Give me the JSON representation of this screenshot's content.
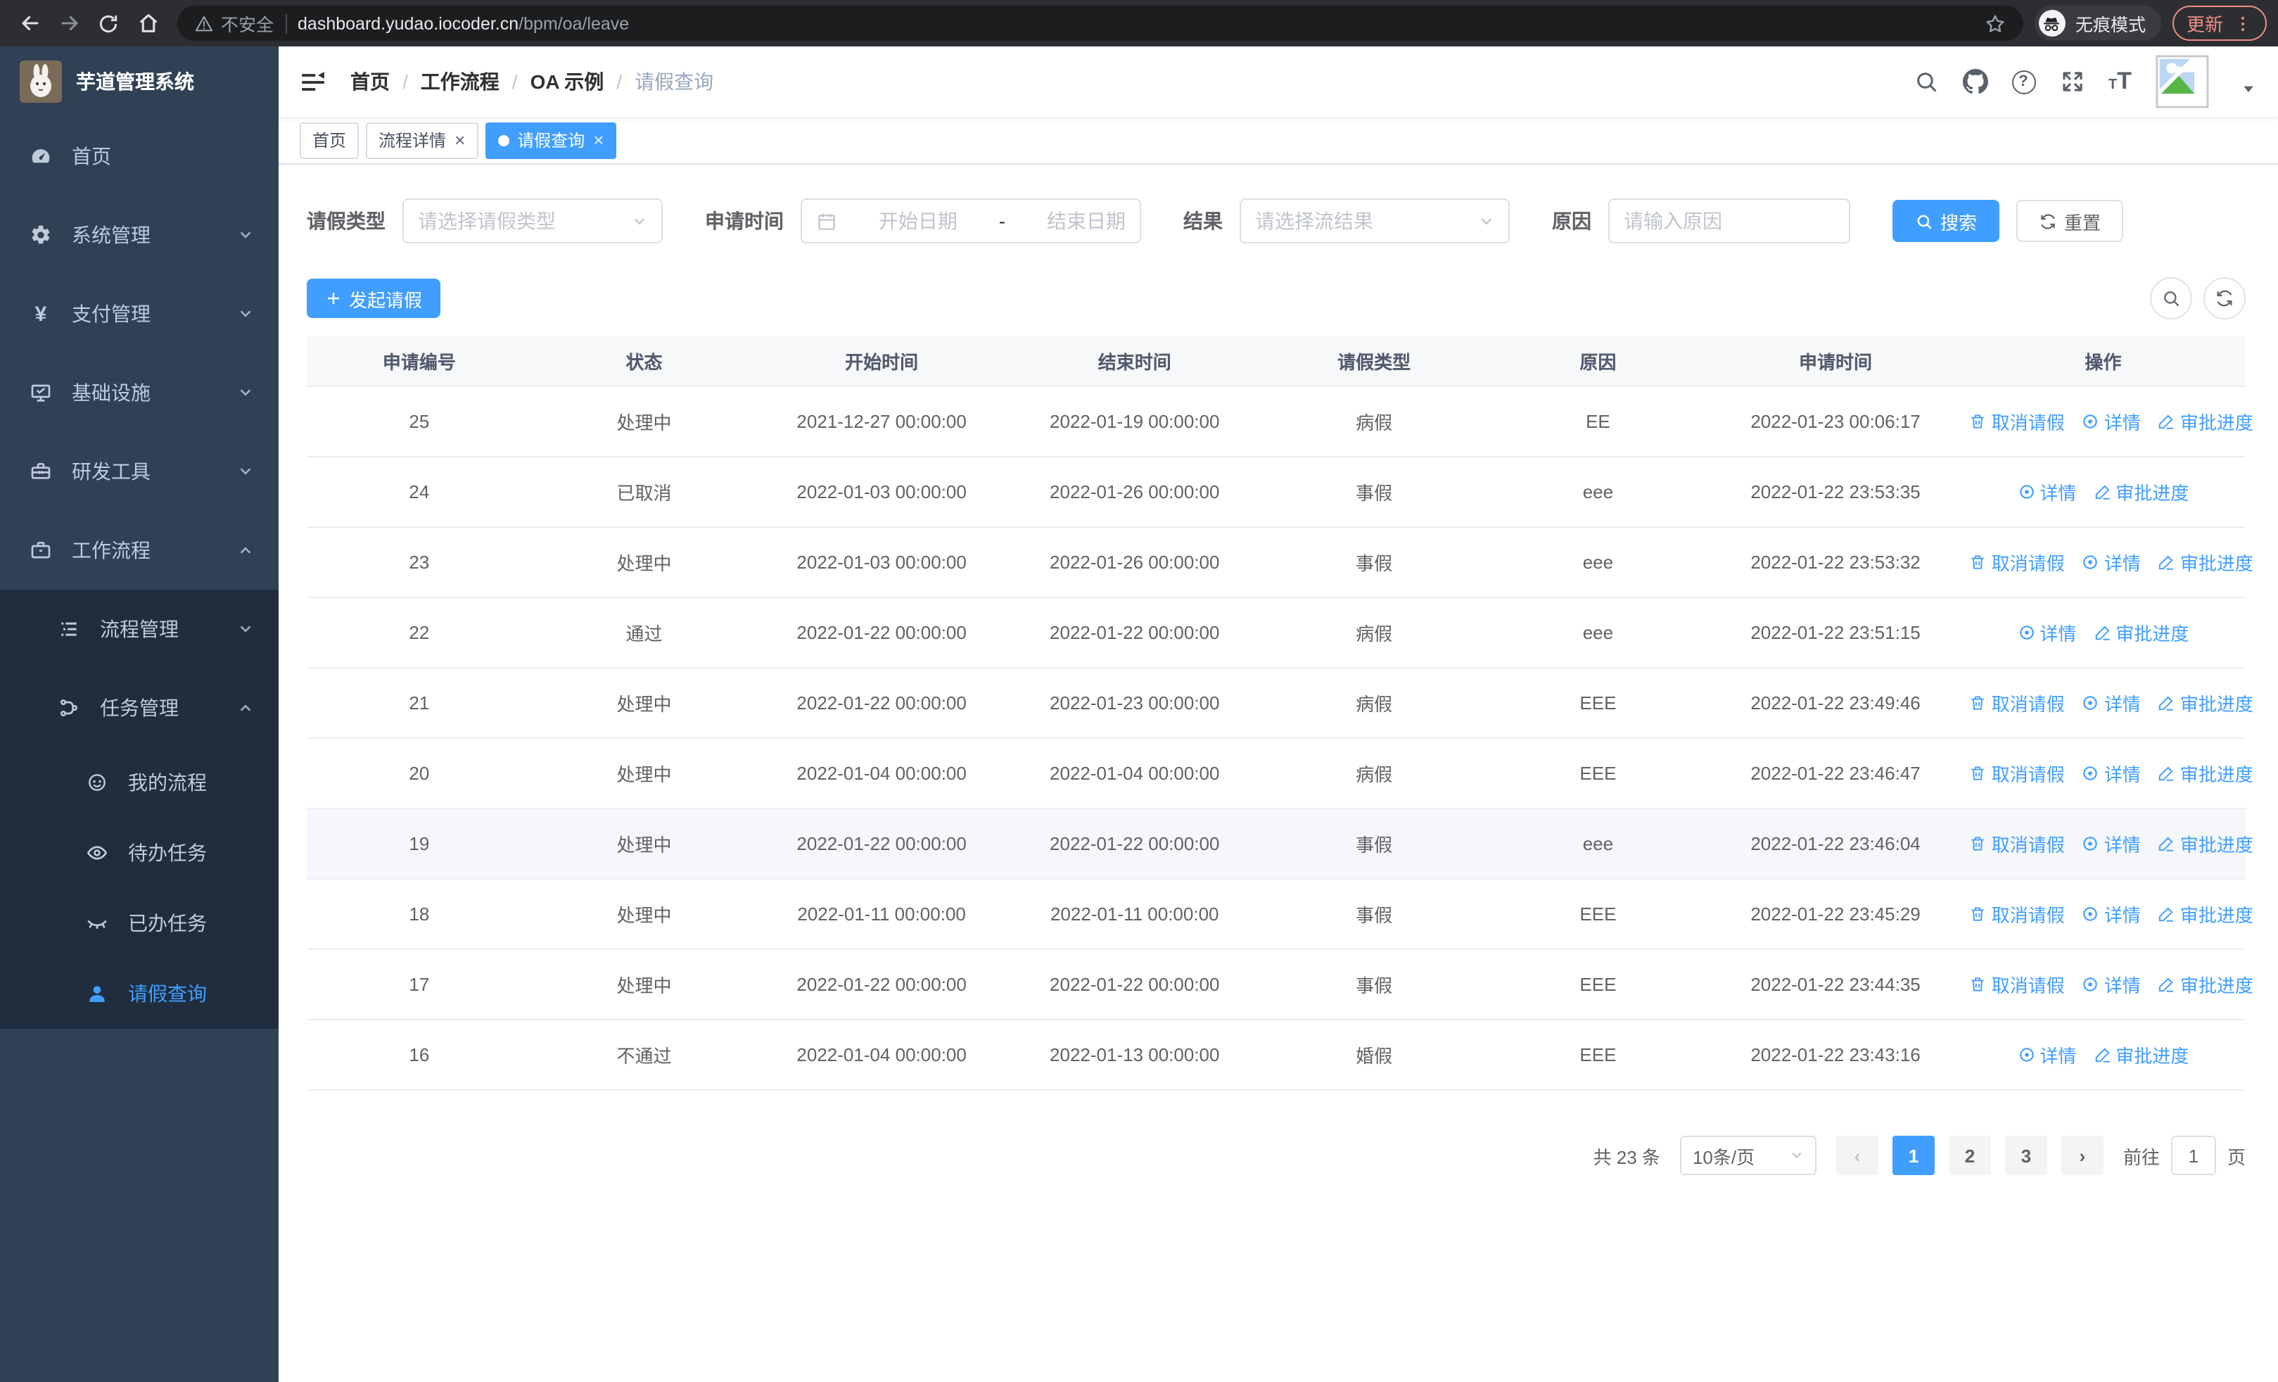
{
  "browser": {
    "security_label": "不安全",
    "url_host": "dashboard.yudao.iocoder.cn",
    "url_path": "/bpm/oa/leave",
    "incognito_label": "无痕模式",
    "update_label": "更新"
  },
  "sidebar": {
    "logo_title": "芋道管理系统",
    "menu": [
      {
        "name": "home",
        "label": "首页",
        "icon": "dashboard",
        "level": 1
      },
      {
        "name": "system-mgmt",
        "label": "系统管理",
        "icon": "gear",
        "level": 1,
        "chevron": "down"
      },
      {
        "name": "payment-mgmt",
        "label": "支付管理",
        "icon": "yen",
        "level": 1,
        "chevron": "down"
      },
      {
        "name": "infrastructure",
        "label": "基础设施",
        "icon": "monitor",
        "level": 1,
        "chevron": "down"
      },
      {
        "name": "dev-tools",
        "label": "研发工具",
        "icon": "toolbox",
        "level": 1,
        "chevron": "down"
      },
      {
        "name": "workflow",
        "label": "工作流程",
        "icon": "briefcase",
        "level": 1,
        "chevron": "up"
      }
    ],
    "submenu": [
      {
        "name": "process-mgmt",
        "label": "流程管理",
        "icon": "list",
        "level": 2,
        "chevron": "down"
      },
      {
        "name": "task-mgmt",
        "label": "任务管理",
        "icon": "flow",
        "level": 2,
        "chevron": "up"
      },
      {
        "name": "my-process",
        "label": "我的流程",
        "icon": "face",
        "level": 3
      },
      {
        "name": "todo-tasks",
        "label": "待办任务",
        "icon": "eye",
        "level": 3
      },
      {
        "name": "done-tasks",
        "label": "已办任务",
        "icon": "eye-closed",
        "level": 3
      },
      {
        "name": "leave-query",
        "label": "请假查询",
        "icon": "user",
        "level": 3,
        "active": true
      }
    ]
  },
  "header": {
    "breadcrumb": [
      "首页",
      "工作流程",
      "OA 示例",
      "请假查询"
    ]
  },
  "tabs": [
    {
      "name": "home",
      "label": "首页",
      "closable": false,
      "active": false
    },
    {
      "name": "process-detail",
      "label": "流程详情",
      "closable": true,
      "active": false
    },
    {
      "name": "leave-query",
      "label": "请假查询",
      "closable": true,
      "active": true
    }
  ],
  "filters": {
    "leave_type_label": "请假类型",
    "leave_type_placeholder": "请选择请假类型",
    "apply_time_label": "申请时间",
    "date_start_placeholder": "开始日期",
    "date_separator": "-",
    "date_end_placeholder": "结束日期",
    "result_label": "结果",
    "result_placeholder": "请选择流结果",
    "reason_label": "原因",
    "reason_placeholder": "请输入原因",
    "search_button": "搜索",
    "reset_button": "重置"
  },
  "toolbar": {
    "create_button": "发起请假"
  },
  "table": {
    "columns": [
      "申请编号",
      "状态",
      "开始时间",
      "结束时间",
      "请假类型",
      "原因",
      "申请时间",
      "操作"
    ],
    "action_labels": {
      "cancel": "取消请假",
      "detail": "详情",
      "progress": "审批进度"
    },
    "rows": [
      {
        "id": "25",
        "status": "处理中",
        "start": "2021-12-27 00:00:00",
        "end": "2022-01-19 00:00:00",
        "type": "病假",
        "reason": "EE",
        "apply_time": "2022-01-23 00:06:17",
        "actions": [
          "cancel",
          "detail",
          "progress"
        ]
      },
      {
        "id": "24",
        "status": "已取消",
        "start": "2022-01-03 00:00:00",
        "end": "2022-01-26 00:00:00",
        "type": "事假",
        "reason": "eee",
        "apply_time": "2022-01-22 23:53:35",
        "actions": [
          "detail",
          "progress"
        ]
      },
      {
        "id": "23",
        "status": "处理中",
        "start": "2022-01-03 00:00:00",
        "end": "2022-01-26 00:00:00",
        "type": "事假",
        "reason": "eee",
        "apply_time": "2022-01-22 23:53:32",
        "actions": [
          "cancel",
          "detail",
          "progress"
        ]
      },
      {
        "id": "22",
        "status": "通过",
        "start": "2022-01-22 00:00:00",
        "end": "2022-01-22 00:00:00",
        "type": "病假",
        "reason": "eee",
        "apply_time": "2022-01-22 23:51:15",
        "actions": [
          "detail",
          "progress"
        ]
      },
      {
        "id": "21",
        "status": "处理中",
        "start": "2022-01-22 00:00:00",
        "end": "2022-01-23 00:00:00",
        "type": "病假",
        "reason": "EEE",
        "apply_time": "2022-01-22 23:49:46",
        "actions": [
          "cancel",
          "detail",
          "progress"
        ]
      },
      {
        "id": "20",
        "status": "处理中",
        "start": "2022-01-04 00:00:00",
        "end": "2022-01-04 00:00:00",
        "type": "病假",
        "reason": "EEE",
        "apply_time": "2022-01-22 23:46:47",
        "actions": [
          "cancel",
          "detail",
          "progress"
        ]
      },
      {
        "id": "19",
        "status": "处理中",
        "start": "2022-01-22 00:00:00",
        "end": "2022-01-22 00:00:00",
        "type": "事假",
        "reason": "eee",
        "apply_time": "2022-01-22 23:46:04",
        "actions": [
          "cancel",
          "detail",
          "progress"
        ],
        "highlighted": true
      },
      {
        "id": "18",
        "status": "处理中",
        "start": "2022-01-11 00:00:00",
        "end": "2022-01-11 00:00:00",
        "type": "事假",
        "reason": "EEE",
        "apply_time": "2022-01-22 23:45:29",
        "actions": [
          "cancel",
          "detail",
          "progress"
        ]
      },
      {
        "id": "17",
        "status": "处理中",
        "start": "2022-01-22 00:00:00",
        "end": "2022-01-22 00:00:00",
        "type": "事假",
        "reason": "EEE",
        "apply_time": "2022-01-22 23:44:35",
        "actions": [
          "cancel",
          "detail",
          "progress"
        ]
      },
      {
        "id": "16",
        "status": "不通过",
        "start": "2022-01-04 00:00:00",
        "end": "2022-01-13 00:00:00",
        "type": "婚假",
        "reason": "EEE",
        "apply_time": "2022-01-22 23:43:16",
        "actions": [
          "detail",
          "progress"
        ]
      }
    ]
  },
  "pagination": {
    "total_text": "共 23 条",
    "page_size": "10条/页",
    "pages": [
      "1",
      "2",
      "3"
    ],
    "current_page": "1",
    "goto_label": "前往",
    "goto_value": "1",
    "goto_unit": "页"
  },
  "colors": {
    "primary": "#409EFF",
    "sidebar_bg": "#304156",
    "submenu_bg": "#1F2D3D",
    "update_accent": "#EE8E86"
  }
}
